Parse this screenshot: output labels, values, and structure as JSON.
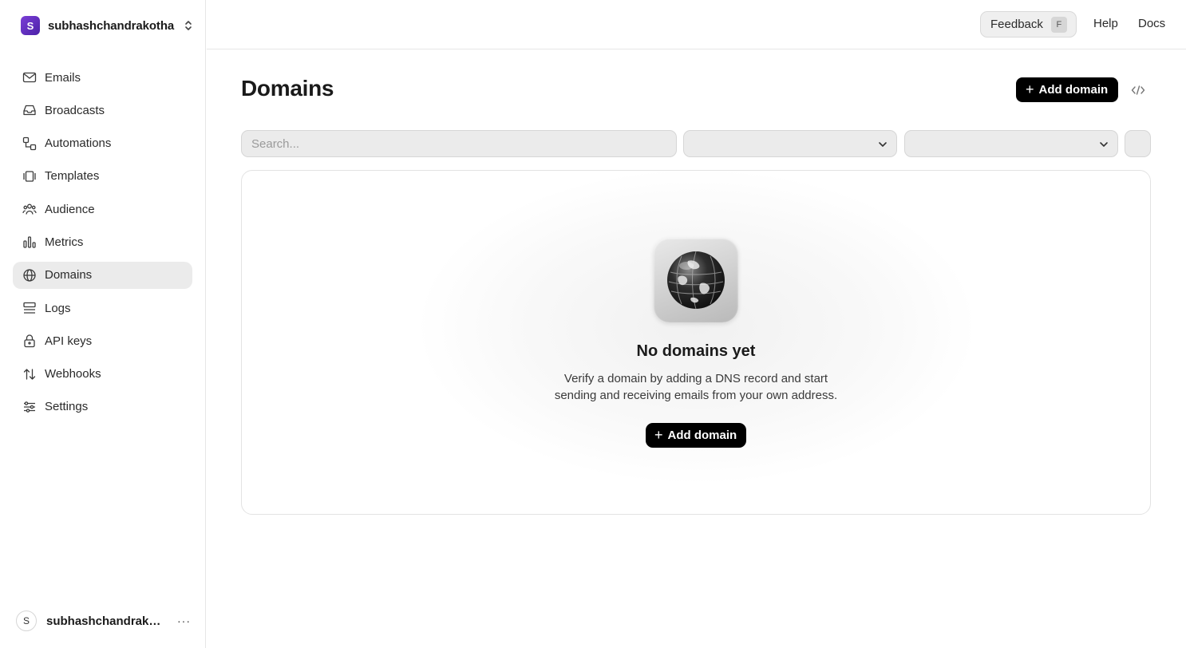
{
  "team": {
    "initial": "S",
    "name": "subhashchandrakotha"
  },
  "sidebar": {
    "items": [
      {
        "label": "Emails",
        "icon": "mail-icon",
        "active": false
      },
      {
        "label": "Broadcasts",
        "icon": "inbox-icon",
        "active": false
      },
      {
        "label": "Automations",
        "icon": "workflow-icon",
        "active": false
      },
      {
        "label": "Templates",
        "icon": "template-icon",
        "active": false
      },
      {
        "label": "Audience",
        "icon": "users-icon",
        "active": false
      },
      {
        "label": "Metrics",
        "icon": "bar-chart-icon",
        "active": false
      },
      {
        "label": "Domains",
        "icon": "globe-icon",
        "active": true
      },
      {
        "label": "Logs",
        "icon": "logs-icon",
        "active": false
      },
      {
        "label": "API keys",
        "icon": "lock-icon",
        "active": false
      },
      {
        "label": "Webhooks",
        "icon": "arrows-updown-icon",
        "active": false
      },
      {
        "label": "Settings",
        "icon": "sliders-icon",
        "active": false
      }
    ]
  },
  "user": {
    "initial": "S",
    "name": "subhashchandrakotha",
    "more": "···"
  },
  "topbar": {
    "feedback_label": "Feedback",
    "feedback_shortcut": "F",
    "help_label": "Help",
    "docs_label": "Docs"
  },
  "page": {
    "title": "Domains",
    "add_label": "Add domain"
  },
  "filters": {
    "search_placeholder": "Search...",
    "select1_value": "",
    "select2_value": ""
  },
  "empty_state": {
    "title": "No domains yet",
    "desc_line1": "Verify a domain by adding a DNS record and start",
    "desc_line2": "sending and receiving emails from your own address.",
    "add_label": "Add domain"
  }
}
